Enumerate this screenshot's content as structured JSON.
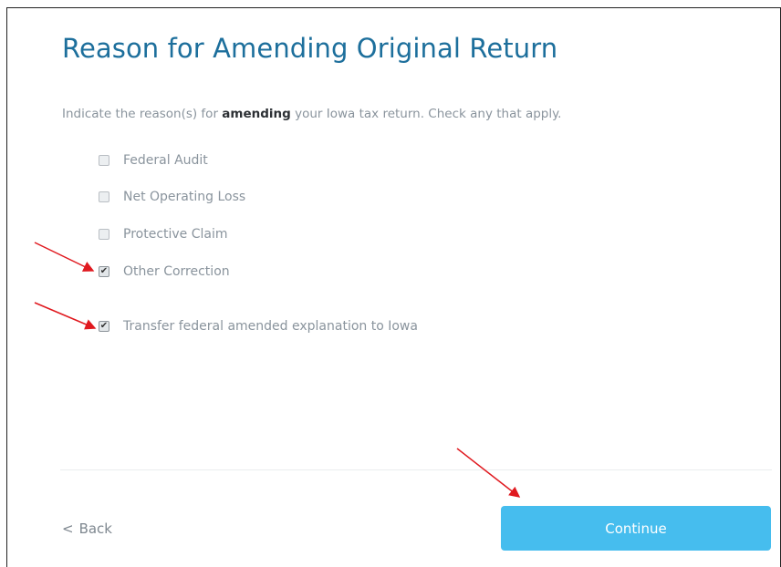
{
  "page": {
    "title": "Reason for Amending Original Return",
    "instructions": {
      "before": "Indicate the reason(s) for ",
      "bold": "amending",
      "after": " your Iowa tax return. Check any that apply."
    }
  },
  "options": [
    {
      "label": "Federal Audit",
      "checked": false
    },
    {
      "label": "Net Operating Loss",
      "checked": false
    },
    {
      "label": "Protective Claim",
      "checked": false
    },
    {
      "label": "Other Correction",
      "checked": true
    },
    {
      "label": "Transfer federal amended explanation to Iowa",
      "checked": true
    }
  ],
  "footer": {
    "back_chevron": "<",
    "back_label": "Back",
    "continue_label": "Continue"
  },
  "colors": {
    "title": "#1d6f9c",
    "continue_button": "#46bdee",
    "annotation_arrow": "#e0191f"
  },
  "icons": {
    "checkbox_checked": "check-mark-icon",
    "back": "chevron-left-icon",
    "annotation": "red-arrow-icon"
  }
}
